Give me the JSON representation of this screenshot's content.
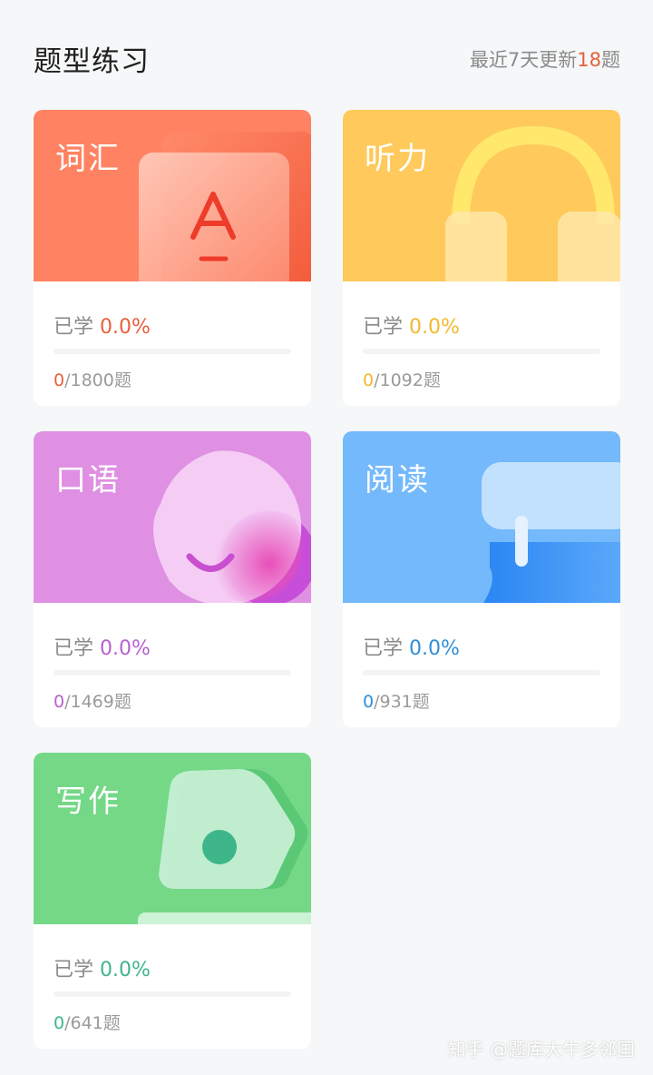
{
  "header": {
    "title": "题型练习",
    "update_prefix": "最近7天更新",
    "update_count": "18",
    "update_suffix": "题"
  },
  "cards": [
    {
      "title": "词汇",
      "studied_label": "已学",
      "percent": "0.0%",
      "done": "0",
      "total": "/1800题",
      "progress": 0,
      "accent": "#e8603c",
      "banner_color": "#ff8262"
    },
    {
      "title": "听力",
      "studied_label": "已学",
      "percent": "0.0%",
      "done": "0",
      "total": "/1092题",
      "progress": 0,
      "accent": "#f2b930",
      "banner_color": "#ffc95c"
    },
    {
      "title": "口语",
      "studied_label": "已学",
      "percent": "0.0%",
      "done": "0",
      "total": "/1469题",
      "progress": 0,
      "accent": "#b85fd0",
      "banner_color": "#df90e3"
    },
    {
      "title": "阅读",
      "studied_label": "已学",
      "percent": "0.0%",
      "done": "0",
      "total": "/931题",
      "progress": 0,
      "accent": "#2f8fd8",
      "banner_color": "#74b9fb"
    },
    {
      "title": "写作",
      "studied_label": "已学",
      "percent": "0.0%",
      "done": "0",
      "total": "/641题",
      "progress": 0,
      "accent": "#3fb58a",
      "banner_color": "#74d887"
    }
  ],
  "watermark": "知乎 @题库大牛多邻国"
}
